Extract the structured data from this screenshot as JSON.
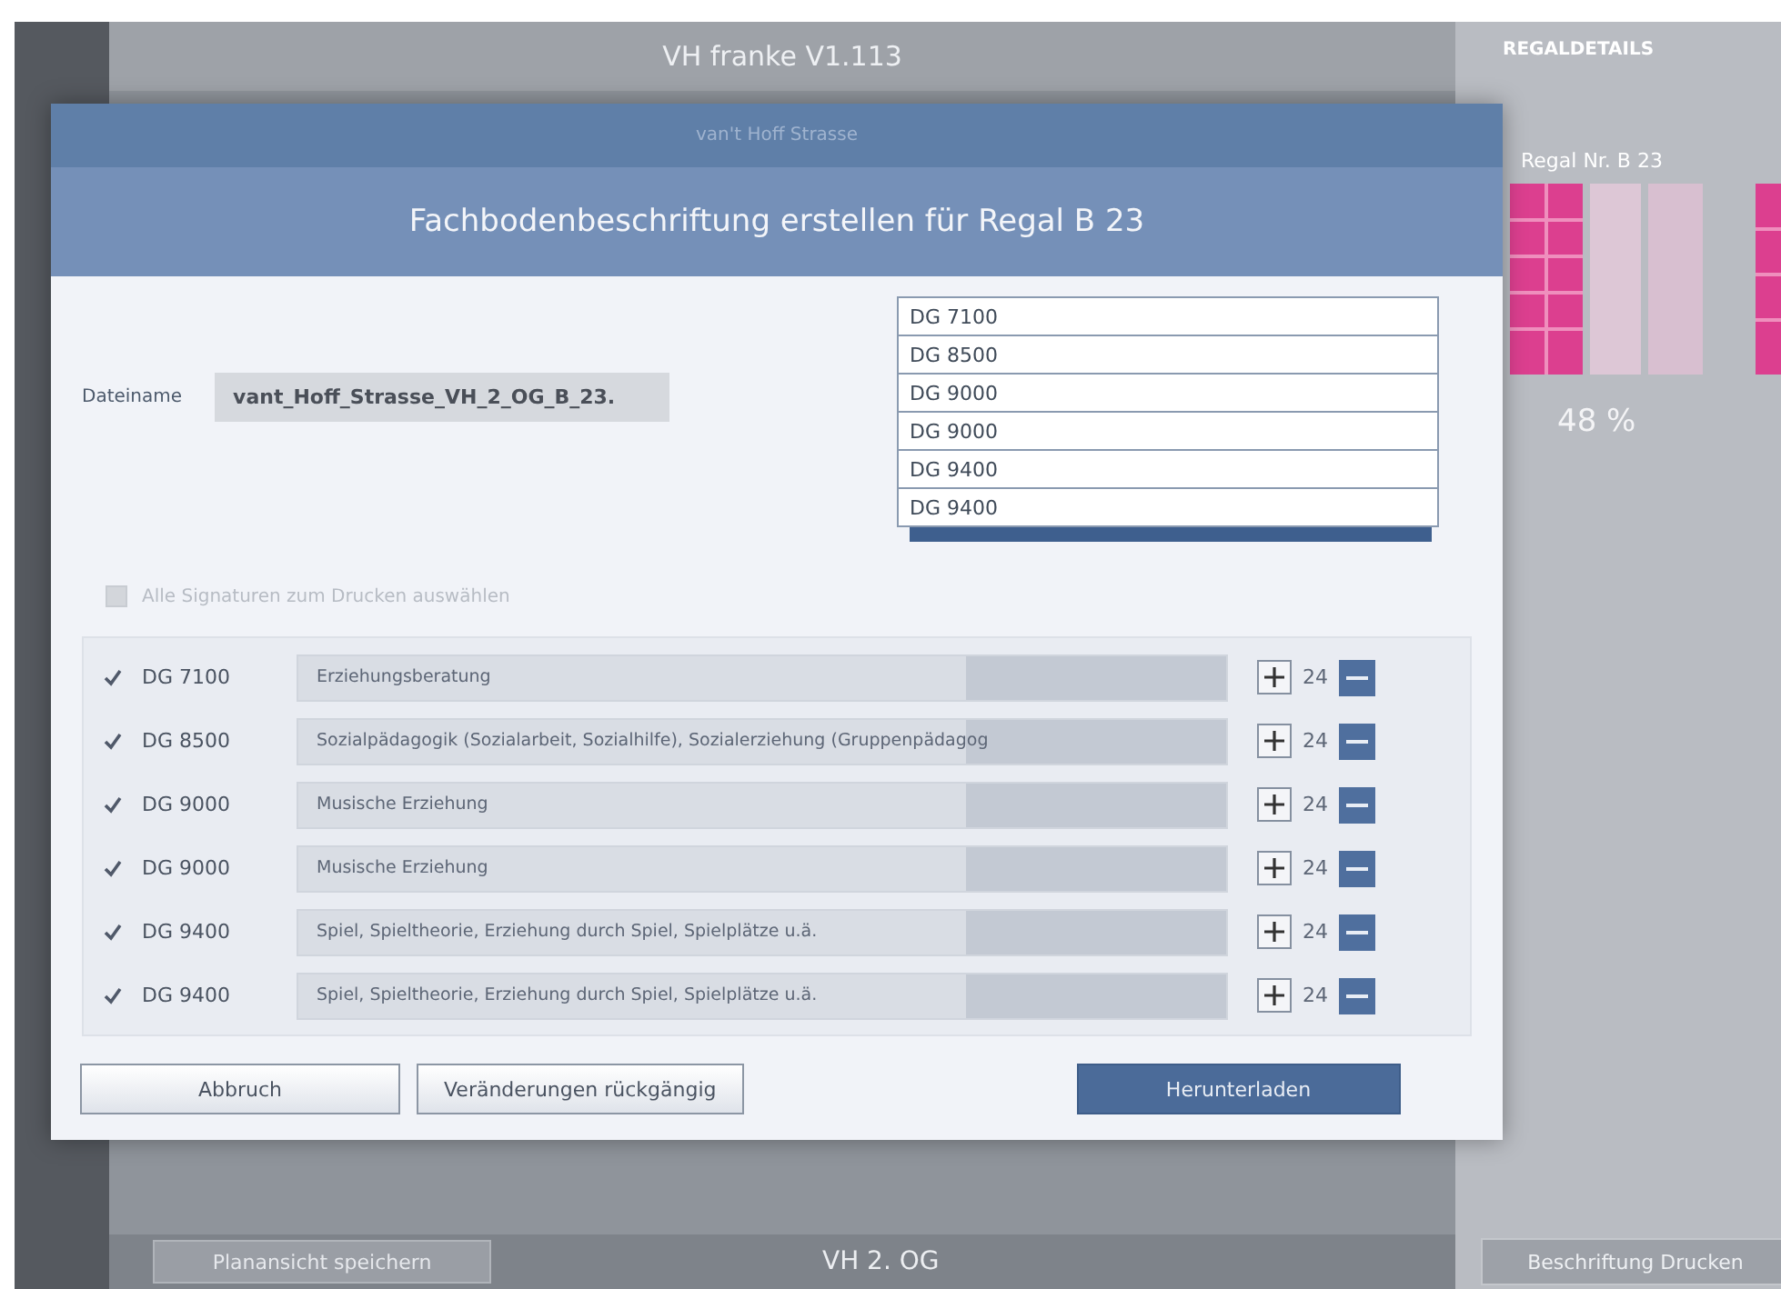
{
  "app": {
    "title": "VH franke V1.113",
    "floor": "VH 2. OG",
    "save_view_button": "Planansicht speichern"
  },
  "details": {
    "heading": "REGALDETAILS",
    "shelf": "Regal Nr. B 23",
    "fill": "48 %",
    "print_button": "Beschriftung Drucken"
  },
  "dialog": {
    "subtitle": "van't Hoff Strasse",
    "title": "Fachbodenbeschriftung erstellen für Regal B 23",
    "filename_label": "Dateiname",
    "filename": "vant_Hoff_Strasse_VH_2_OG_B_23.",
    "signatures": [
      {
        "label": "DG 7100"
      },
      {
        "label": "DG 8500"
      },
      {
        "label": "DG 9000"
      },
      {
        "label": "DG 9000"
      },
      {
        "label": "DG 9400"
      },
      {
        "label": "DG 9400"
      }
    ],
    "select_all": {
      "label": "Alle Signaturen zum Drucken auswählen",
      "checked": false,
      "disabled": true
    },
    "rows": [
      {
        "checked": true,
        "signature": "DG 7100",
        "text": "Erziehungsberatung",
        "count": "24"
      },
      {
        "checked": true,
        "signature": "DG 8500",
        "text": "Sozialpädagogik (Sozialarbeit, Sozialhilfe), Sozialerziehung (Gruppenpädagog",
        "count": "24"
      },
      {
        "checked": true,
        "signature": "DG 9000",
        "text": "Musische Erziehung",
        "count": "24"
      },
      {
        "checked": true,
        "signature": "DG 9000",
        "text": "Musische Erziehung",
        "count": "24"
      },
      {
        "checked": true,
        "signature": "DG 9400",
        "text": "Spiel, Spieltheorie, Erziehung durch Spiel, Spielplätze u.ä.",
        "count": "24"
      },
      {
        "checked": true,
        "signature": "DG 9400",
        "text": "Spiel, Spieltheorie, Erziehung durch Spiel, Spielplätze u.ä.",
        "count": "24"
      }
    ],
    "buttons": [
      {
        "label": "Abbruch",
        "kind": "plain"
      },
      {
        "label": "Veränderungen rückgängig",
        "kind": "plain"
      },
      {
        "label": "Herunterladen",
        "kind": "primary"
      }
    ]
  }
}
